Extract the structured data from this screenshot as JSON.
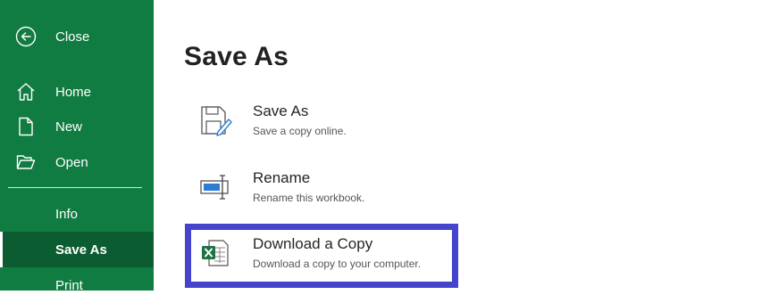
{
  "sidebar": {
    "items": [
      {
        "label": "Close",
        "icon": "back-arrow-icon"
      },
      {
        "label": "Home",
        "icon": "home-icon"
      },
      {
        "label": "New",
        "icon": "new-document-icon"
      },
      {
        "label": "Open",
        "icon": "folder-open-icon"
      },
      {
        "label": "Info",
        "icon": ""
      },
      {
        "label": "Save As",
        "icon": "",
        "selected": true
      },
      {
        "label": "Print",
        "icon": ""
      }
    ]
  },
  "main": {
    "title": "Save As",
    "options": [
      {
        "title": "Save As",
        "description": "Save a copy online.",
        "icon": "save-as-icon"
      },
      {
        "title": "Rename",
        "description": "Rename this workbook.",
        "icon": "rename-icon"
      },
      {
        "title": "Download a Copy",
        "description": "Download a copy to your computer.",
        "icon": "excel-file-icon",
        "highlighted": true
      }
    ]
  },
  "colors": {
    "rail": "#107c41",
    "rail_selected": "#0b5c30",
    "highlight_border": "#4444cc",
    "excel_green": "#1e7145"
  }
}
